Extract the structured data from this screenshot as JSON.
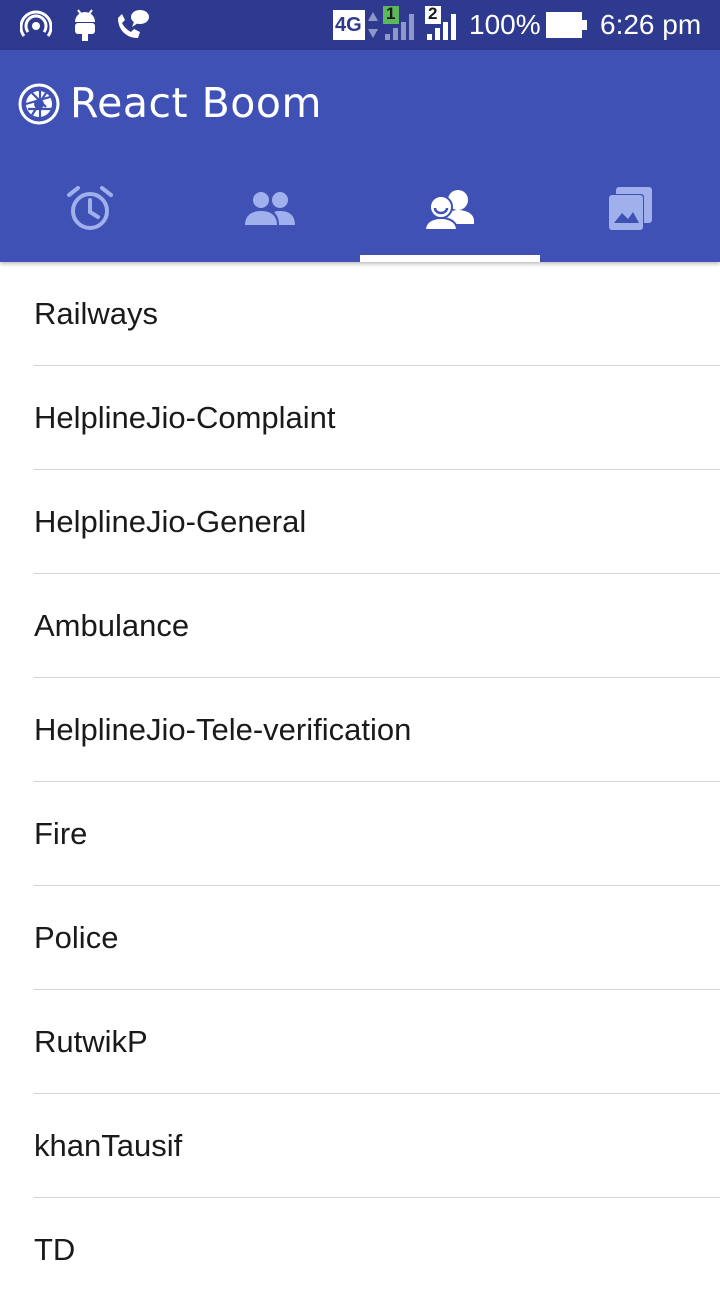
{
  "status_bar": {
    "network_label": "4G",
    "sim1_label": "1",
    "sim2_label": "2",
    "battery": "100%",
    "time": "6:26 pm",
    "icons": [
      "hotspot-icon",
      "android-icon",
      "wifi-calling-icon",
      "network-4g-icon",
      "signal-sim1-icon",
      "signal-sim2-icon",
      "battery-icon"
    ]
  },
  "app_bar": {
    "title": "React Boom",
    "logo_icon": "aperture-icon",
    "background": "#3f51b5"
  },
  "tabs": [
    {
      "icon": "alarm-icon",
      "active": false
    },
    {
      "icon": "people-icon",
      "active": false
    },
    {
      "icon": "contacts-icon",
      "active": true
    },
    {
      "icon": "photo-library-icon",
      "active": false
    }
  ],
  "contacts": [
    {
      "name": "Railways"
    },
    {
      "name": "HelplineJio-Complaint"
    },
    {
      "name": "HelplineJio-General"
    },
    {
      "name": "Ambulance"
    },
    {
      "name": "HelplineJio-Tele-verification"
    },
    {
      "name": "Fire"
    },
    {
      "name": "Police"
    },
    {
      "name": "RutwikP"
    },
    {
      "name": "khanTausif"
    },
    {
      "name": "TD"
    }
  ],
  "colors": {
    "status_bar": "#2e3a8f",
    "primary": "#3f51b5",
    "inactive_tab_icon": "#9fb0ec",
    "active_tab_icon": "#ffffff"
  }
}
